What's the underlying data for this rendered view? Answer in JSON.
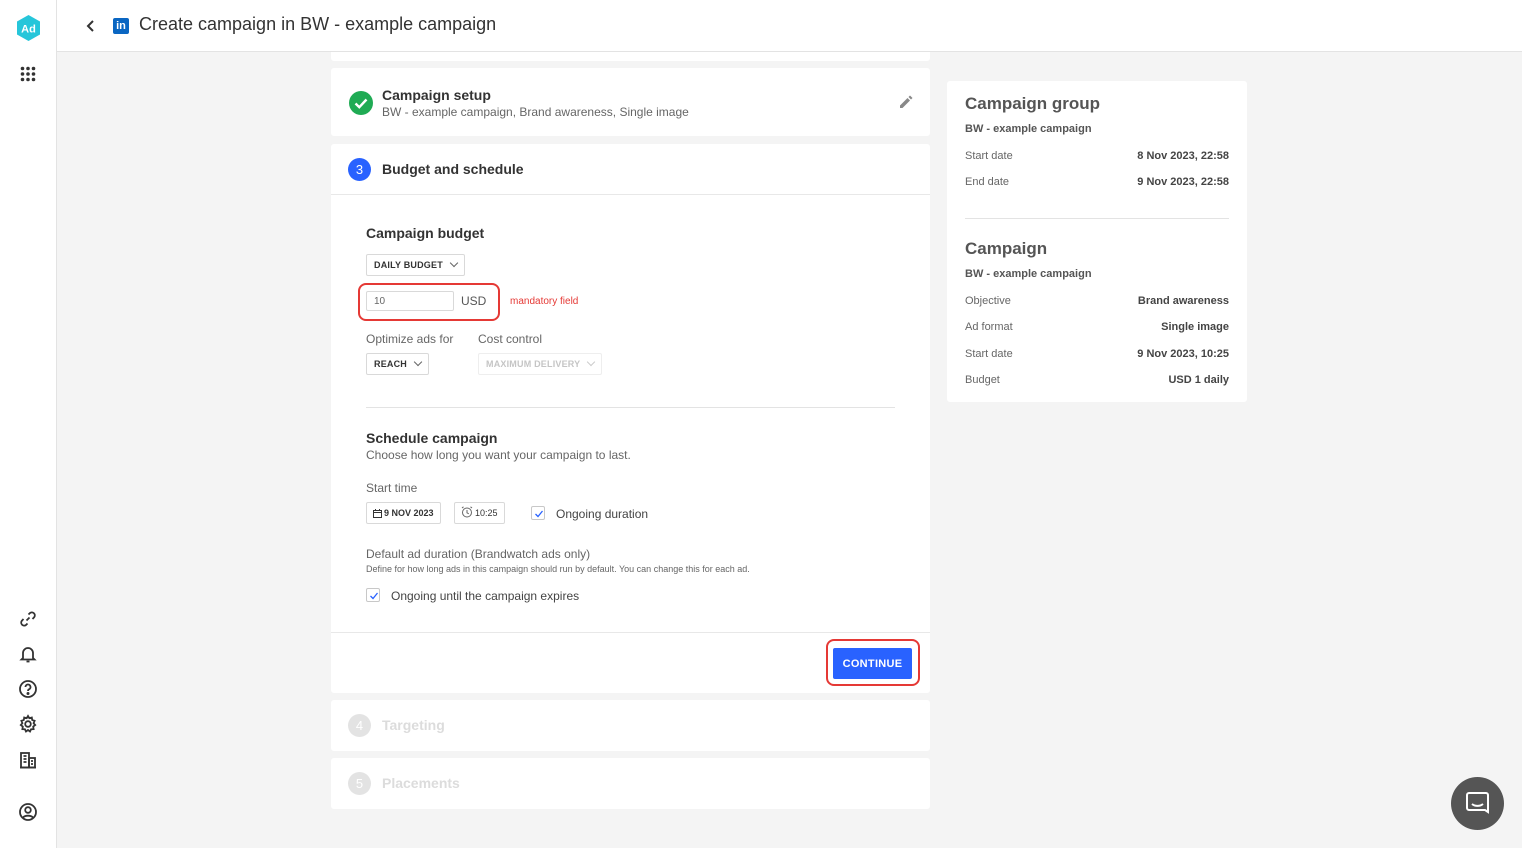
{
  "header": {
    "title": "Create campaign in BW - example campaign"
  },
  "rail": {
    "logo_text": "Ad"
  },
  "steps": {
    "setup": {
      "title": "Campaign setup",
      "summary": "BW - example campaign, Brand awareness, Single image"
    },
    "budget": {
      "number": "3",
      "title": "Budget and schedule"
    },
    "targeting": {
      "number": "4",
      "title": "Targeting"
    },
    "placements": {
      "number": "5",
      "title": "Placements"
    }
  },
  "budget": {
    "heading": "Campaign budget",
    "type_dropdown": "DAILY BUDGET",
    "amount_value": "10",
    "currency": "USD",
    "mandatory_text": "mandatory field",
    "optimize_label": "Optimize ads for",
    "optimize_value": "REACH",
    "cost_control_label": "Cost control",
    "cost_control_value": "MAXIMUM DELIVERY"
  },
  "schedule": {
    "heading": "Schedule campaign",
    "subtitle": "Choose how long you want your campaign to last.",
    "start_time_label": "Start time",
    "start_date": "9 NOV 2023",
    "start_clock": "10:25",
    "ongoing_label": "Ongoing duration",
    "ongoing_checked": true,
    "default_duration_label": "Default ad duration (Brandwatch ads only)",
    "default_duration_help": "Define for how long ads in this campaign should run by default. You can change this for each ad.",
    "ongoing_until_label": "Ongoing until the campaign expires",
    "ongoing_until_checked": true
  },
  "actions": {
    "continue_label": "CONTINUE"
  },
  "summary": {
    "group": {
      "heading": "Campaign group",
      "name": "BW - example campaign",
      "rows": [
        {
          "key": "Start date",
          "value": "8 Nov 2023, 22:58"
        },
        {
          "key": "End date",
          "value": "9 Nov 2023, 22:58"
        }
      ]
    },
    "campaign": {
      "heading": "Campaign",
      "name": "BW - example campaign",
      "rows": [
        {
          "key": "Objective",
          "value": "Brand awareness"
        },
        {
          "key": "Ad format",
          "value": "Single image"
        },
        {
          "key": "Start date",
          "value": "9 Nov 2023, 10:25"
        },
        {
          "key": "Budget",
          "value": "USD 1 daily"
        }
      ]
    }
  },
  "colors": {
    "accent": "#2962ff",
    "success": "#1fab54",
    "error": "#e53935",
    "linkedin": "#0a66c2"
  }
}
